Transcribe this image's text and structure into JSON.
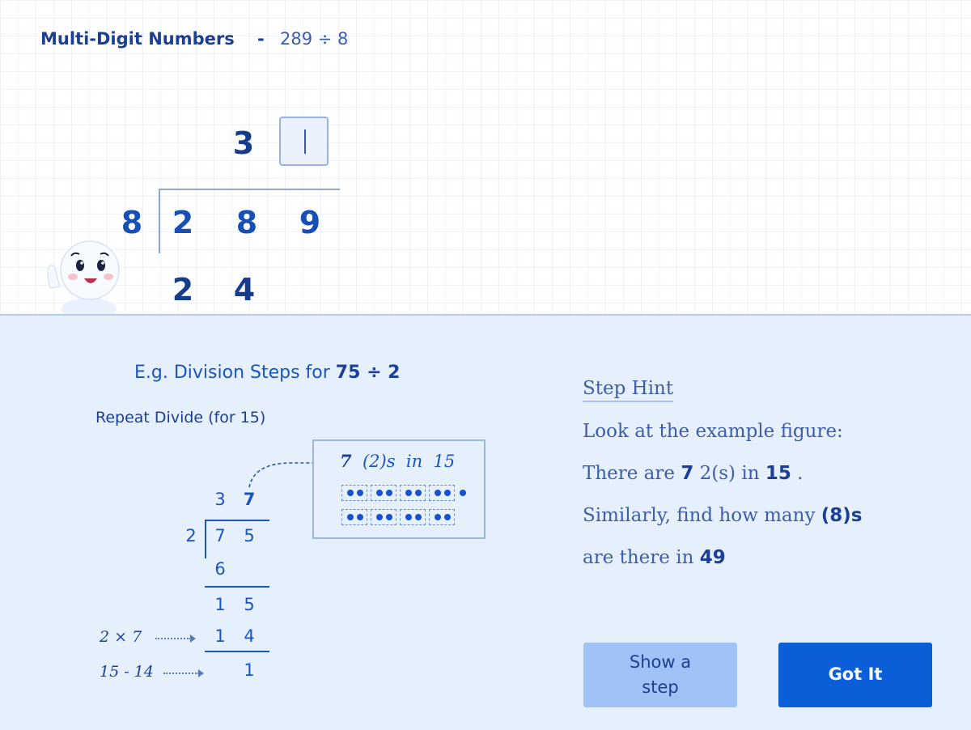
{
  "header": {
    "title": "Multi-Digit Numbers",
    "separator": "-",
    "problem": "289 ÷ 8"
  },
  "work": {
    "divisor": "8",
    "dividend_digits": [
      "2",
      "8",
      "9"
    ],
    "quotient_digit": "3",
    "answer_value": "",
    "product_digits": [
      "2",
      "4"
    ]
  },
  "example": {
    "title_prefix": "E.g. Division Steps for ",
    "title_expr": "75 ÷ 2",
    "subtitle": "Repeat Divide (for 15)",
    "figure": {
      "count": "7",
      "group_label": "(2)s",
      "in_word": "in",
      "total": "15",
      "row1_groups": 4,
      "row1_extra_dots": 1,
      "row2_groups": 4
    },
    "division": {
      "quotient": [
        "3",
        "7"
      ],
      "divisor": "2",
      "dividend": [
        "7",
        "5"
      ],
      "step1": "6",
      "step2": [
        "1",
        "5"
      ],
      "step3": [
        "1",
        "4"
      ],
      "remainder": "1"
    },
    "notes": {
      "product": "2 × 7",
      "subtraction": "15 - 14"
    }
  },
  "hint": {
    "heading": "Step Hint",
    "line1": "Look at the example figure:",
    "line2_a": "There are ",
    "line2_count": "7",
    "line2_b": " 2(s) in ",
    "line2_total": "15",
    "line2_c": " .",
    "line3_a": "Similarly, find how many ",
    "line3_group": "(8)s",
    "line4_a": "are there in ",
    "line4_total": "49"
  },
  "buttons": {
    "show_step": "Show a step",
    "got_it": "Got It"
  },
  "colors": {
    "primary": "#0a5fd8",
    "secondary_button": "#9fc3f6",
    "panel_bg": "#e6f0fd",
    "digit": "#1750b4"
  }
}
